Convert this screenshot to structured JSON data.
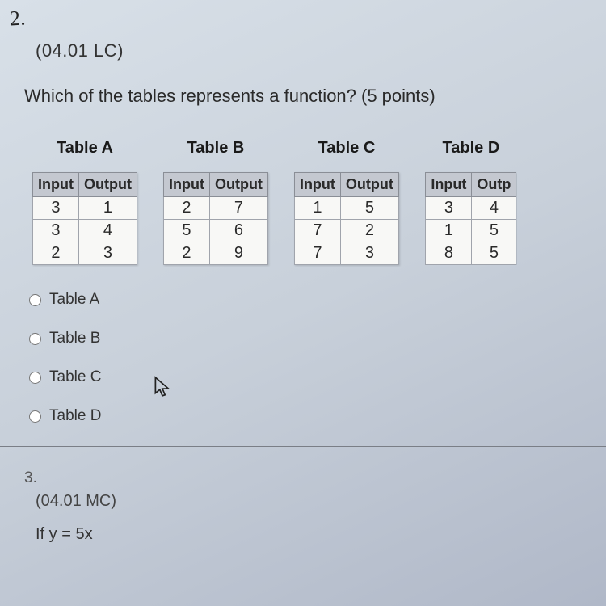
{
  "q_number_hand": "2.",
  "code": "(04.01 LC)",
  "question": "Which of the tables represents a function? (5 points)",
  "headers": {
    "in": "Input",
    "out": "Output"
  },
  "tables": [
    {
      "title": "Table A",
      "rows": [
        [
          3,
          1
        ],
        [
          3,
          4
        ],
        [
          2,
          3
        ]
      ]
    },
    {
      "title": "Table B",
      "rows": [
        [
          2,
          7
        ],
        [
          5,
          6
        ],
        [
          2,
          9
        ]
      ]
    },
    {
      "title": "Table C",
      "rows": [
        [
          1,
          5
        ],
        [
          7,
          2
        ],
        [
          7,
          3
        ]
      ]
    },
    {
      "title": "Table D",
      "rows": [
        [
          3,
          4
        ],
        [
          1,
          5
        ],
        [
          8,
          5
        ]
      ]
    }
  ],
  "tableD_out_header_clipped": "Outp",
  "options": [
    "Table A",
    "Table B",
    "Table C",
    "Table D"
  ],
  "next": {
    "num": "3.",
    "code": "(04.01 MC)",
    "stem": "If y = 5x"
  },
  "chart_data": {
    "type": "table",
    "title": "Identify which input/output table represents a function",
    "tables": {
      "Table A": {
        "Input": [
          3,
          3,
          2
        ],
        "Output": [
          1,
          4,
          3
        ]
      },
      "Table B": {
        "Input": [
          2,
          5,
          2
        ],
        "Output": [
          7,
          6,
          9
        ]
      },
      "Table C": {
        "Input": [
          1,
          7,
          7
        ],
        "Output": [
          5,
          2,
          3
        ]
      },
      "Table D": {
        "Input": [
          3,
          1,
          8
        ],
        "Output": [
          4,
          5,
          5
        ]
      }
    }
  }
}
